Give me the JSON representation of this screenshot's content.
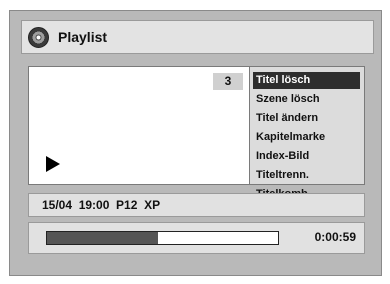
{
  "header": {
    "title": "Playlist",
    "icon": "disc-icon"
  },
  "preview": {
    "title_number": "3"
  },
  "menu": {
    "items": [
      {
        "label": "Titel lösch",
        "selected": true
      },
      {
        "label": "Szene lösch",
        "selected": false
      },
      {
        "label": "Titel ändern",
        "selected": false
      },
      {
        "label": "Kapitelmarke",
        "selected": false
      },
      {
        "label": "Index-Bild",
        "selected": false
      },
      {
        "label": "Titeltrenn.",
        "selected": false
      },
      {
        "label": "Titelkomb.",
        "selected": false
      }
    ]
  },
  "info": {
    "text": "15/04  19:00  P12  XP"
  },
  "progress": {
    "fraction": 0.48,
    "time": "0:00:59"
  },
  "colors": {
    "panel": "#b9b9b9",
    "selected_bg": "#2e2e2e",
    "progress_fill": "#555555"
  }
}
